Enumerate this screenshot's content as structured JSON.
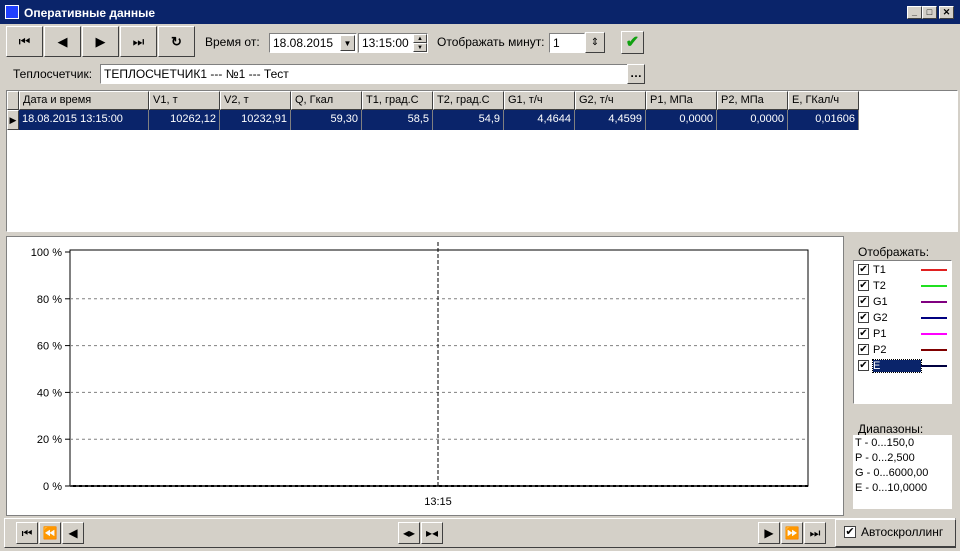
{
  "window": {
    "title": "Оперативные данные"
  },
  "toolbar": {
    "time_from_label": "Время от:",
    "date_value": "18.08.2015",
    "time_value": "13:15:00",
    "minutes_label": "Отображать минут:",
    "minutes_value": "1"
  },
  "meter": {
    "label": "Теплосчетчик:",
    "value": "ТЕПЛОСЧЕТЧИК1  ---  №1  ---  Тест"
  },
  "grid": {
    "headers": [
      "Дата и время",
      "V1, т",
      "V2, т",
      "Q, Гкал",
      "T1, град.С",
      "T2, град.С",
      "G1, т/ч",
      "G2, т/ч",
      "P1, МПа",
      "P2, МПа",
      "E, ГКал/ч"
    ],
    "row": [
      "18.08.2015 13:15:00",
      "10262,12",
      "10232,91",
      "59,30",
      "58,5",
      "54,9",
      "4,4644",
      "4,4599",
      "0,0000",
      "0,0000",
      "0,01606"
    ]
  },
  "chart_data": {
    "type": "line",
    "y_ticks": [
      "100 %",
      "80 %",
      "60 %",
      "40 %",
      "20 %",
      "0 %"
    ],
    "ylim": [
      0,
      100
    ],
    "x_ticks": [
      "13:15"
    ],
    "grid": true,
    "series": []
  },
  "legend": {
    "title": "Отображать:",
    "items": [
      {
        "label": "T1",
        "color": "#e02020",
        "checked": true
      },
      {
        "label": "T2",
        "color": "#20e020",
        "checked": true
      },
      {
        "label": "G1",
        "color": "#800080",
        "checked": true
      },
      {
        "label": "G2",
        "color": "#000080",
        "checked": true
      },
      {
        "label": "P1",
        "color": "#ff00ff",
        "checked": true
      },
      {
        "label": "P2",
        "color": "#800000",
        "checked": true
      },
      {
        "label": "E",
        "color": "#000040",
        "checked": true
      }
    ]
  },
  "ranges": {
    "title": "Диапазоны:",
    "lines": [
      "T - 0...150,0",
      "P - 0...2,500",
      "G - 0...6000,00",
      "E - 0...10,0000"
    ]
  },
  "footer": {
    "autoscroll_label": "Автоскроллинг",
    "autoscroll_checked": true
  }
}
